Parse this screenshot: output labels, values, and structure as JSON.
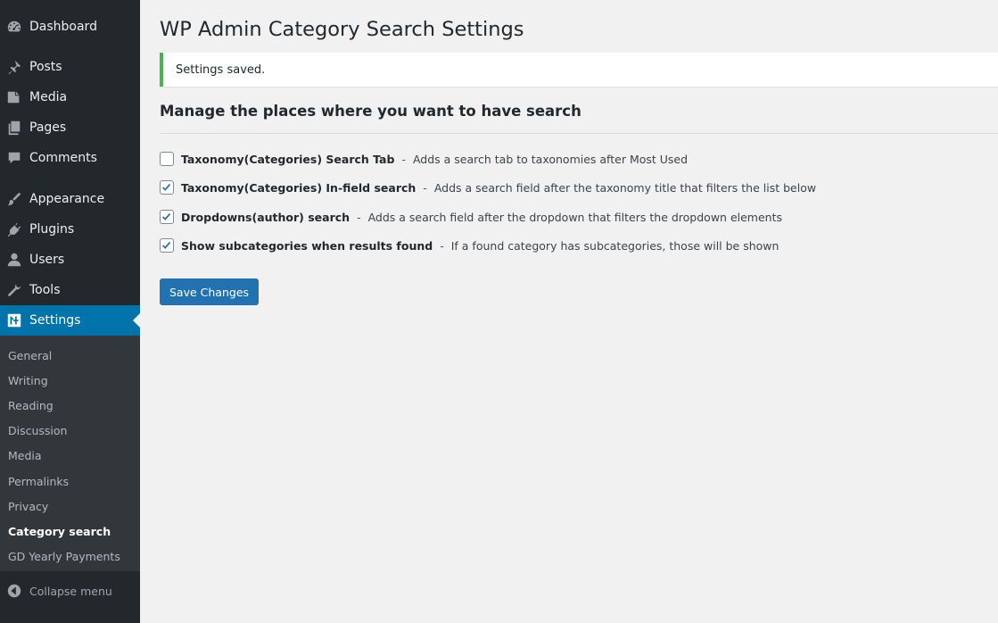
{
  "sidebar": {
    "items": [
      {
        "label": "Dashboard",
        "icon": "dashboard-icon"
      },
      {
        "label": "Posts",
        "icon": "pushpin-icon"
      },
      {
        "label": "Media",
        "icon": "media-icon"
      },
      {
        "label": "Pages",
        "icon": "pages-icon"
      },
      {
        "label": "Comments",
        "icon": "comment-icon"
      },
      {
        "label": "Appearance",
        "icon": "paintbrush-icon"
      },
      {
        "label": "Plugins",
        "icon": "plugin-icon"
      },
      {
        "label": "Users",
        "icon": "user-icon"
      },
      {
        "label": "Tools",
        "icon": "wrench-icon"
      },
      {
        "label": "Settings",
        "icon": "settings-icon"
      }
    ],
    "submenu": [
      "General",
      "Writing",
      "Reading",
      "Discussion",
      "Media",
      "Permalinks",
      "Privacy",
      "Category search",
      "GD Yearly Payments"
    ],
    "collapse_label": "Collapse menu",
    "active_color": "#0073aa",
    "bg_color": "#23282d"
  },
  "main": {
    "title": "WP Admin Category Search Settings",
    "notice": "Settings saved.",
    "section_heading": "Manage the places where you want to have search",
    "options": [
      {
        "label": "Taxonomy(Categories) Search Tab",
        "separator": "-",
        "description": "Adds a search tab to taxonomies after Most Used",
        "checked": false
      },
      {
        "label": "Taxonomy(Categories) In-field search",
        "separator": "-",
        "description": "Adds a search field after the taxonomy title that filters the list below",
        "checked": true
      },
      {
        "label": "Dropdowns(author) search",
        "separator": "-",
        "description": "Adds a search field after the dropdown that filters the dropdown elements",
        "checked": true
      },
      {
        "label": "Show subcategories when results found",
        "separator": "-",
        "description": "If a found category has subcategories, those will be shown",
        "checked": true
      }
    ],
    "save_label": "Save Changes",
    "button_color": "#2271b1",
    "notice_color": "#46b450"
  }
}
